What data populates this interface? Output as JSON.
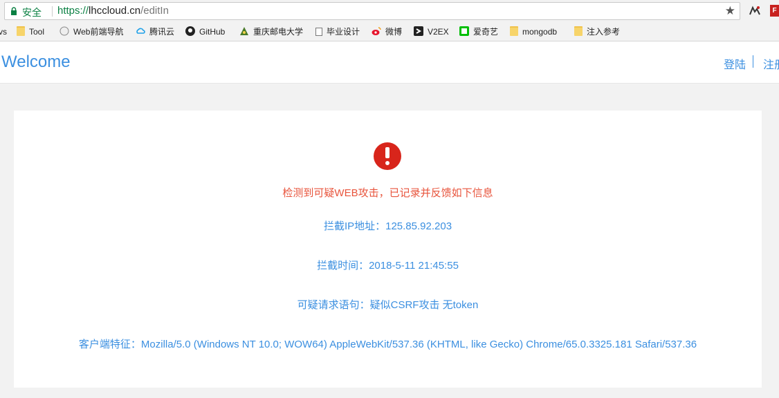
{
  "browser": {
    "secure_label": "安全",
    "url_scheme": "https://",
    "url_host": "lhccloud.cn",
    "url_path": "/editIn",
    "star_icon": "★",
    "ext2_label": "F"
  },
  "bookmarks": [
    {
      "label": "vs",
      "icon": "none"
    },
    {
      "label": "Tool",
      "icon": "folder"
    },
    {
      "label": "Web前端导航",
      "icon": "globe"
    },
    {
      "label": "腾讯云",
      "icon": "cloud"
    },
    {
      "label": "GitHub",
      "icon": "github"
    },
    {
      "label": "重庆邮电大学",
      "icon": "school"
    },
    {
      "label": "毕业设计",
      "icon": "page"
    },
    {
      "label": "微博",
      "icon": "weibo"
    },
    {
      "label": "V2EX",
      "icon": "v2ex"
    },
    {
      "label": "爱奇艺",
      "icon": "iqiyi"
    },
    {
      "label": "mongodb",
      "icon": "folder"
    },
    {
      "label": "注入参考",
      "icon": "folder"
    }
  ],
  "header": {
    "brand": "Welcome",
    "login": "登陆",
    "register": "注册"
  },
  "alert": {
    "warning": "检测到可疑WEB攻击，已记录并反馈如下信息",
    "ip": "拦截IP地址：125.85.92.203",
    "time": "拦截时间：2018-5-11 21:45:55",
    "request": "可疑请求语句：疑似CSRF攻击 无token",
    "user_agent": "客户端特征：Mozilla/5.0 (Windows NT 10.0; WOW64) AppleWebKit/537.36 (KHTML, like Gecko) Chrome/65.0.3325.181 Safari/537.36"
  },
  "colors": {
    "accent": "#3b8fe0",
    "warning": "#e8543c",
    "alert_icon": "#d8251b",
    "secure": "#0b8043"
  }
}
